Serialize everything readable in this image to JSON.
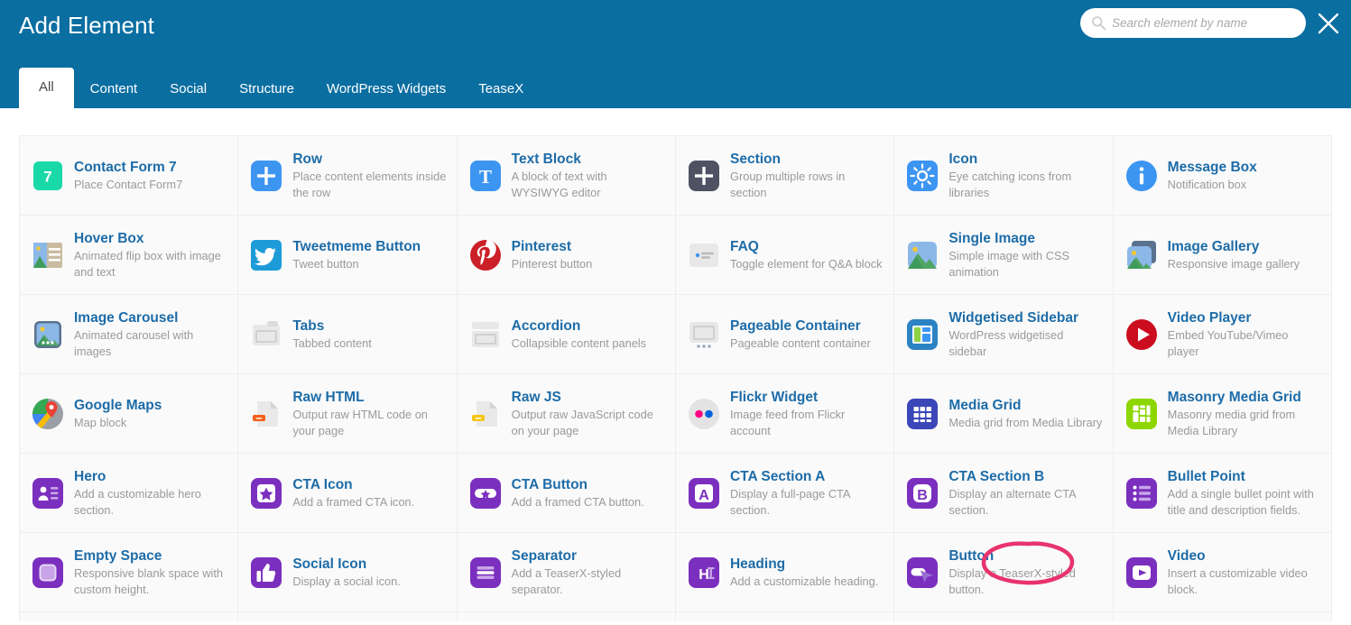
{
  "header": {
    "title": "Add Element",
    "brand_color": "#0a6ea1",
    "accent_color": "#1d6ca8",
    "close_icon": "close-icon"
  },
  "search": {
    "icon": "search-icon",
    "placeholder": "Search element by name",
    "value": ""
  },
  "tabs": [
    {
      "label": "All",
      "active": true
    },
    {
      "label": "Content",
      "active": false
    },
    {
      "label": "Social",
      "active": false
    },
    {
      "label": "Structure",
      "active": false
    },
    {
      "label": "WordPress Widgets",
      "active": false
    },
    {
      "label": "TeaseX",
      "active": false
    }
  ],
  "annotation": {
    "shape": "ellipse",
    "color": "#e8336d",
    "target": "Button",
    "note": "hand-drawn pink ellipse around the Button element title"
  },
  "elements": [
    {
      "title": "Contact Form 7",
      "desc": "Place Contact Form7",
      "icon": "contact-form-7-icon",
      "color": "#1ad9a8"
    },
    {
      "title": "Row",
      "desc": "Place content elements inside the row",
      "icon": "plus-square-icon",
      "color": "#3d95f2"
    },
    {
      "title": "Text Block",
      "desc": "A block of text with WYSIWYG editor",
      "icon": "text-block-icon",
      "color": "#3d95f2"
    },
    {
      "title": "Section",
      "desc": "Group multiple rows in section",
      "icon": "plus-square-dark-icon",
      "color": "#4e5262"
    },
    {
      "title": "Icon",
      "desc": "Eye catching icons from libraries",
      "icon": "sun-icon",
      "color": "#3d95f2"
    },
    {
      "title": "Message Box",
      "desc": "Notification box",
      "icon": "info-circle-icon",
      "color": "#3d95f2"
    },
    {
      "title": "Hover Box",
      "desc": "Animated flip box with image and text",
      "icon": "hover-box-icon",
      "color": "#c9bca0"
    },
    {
      "title": "Tweetmeme Button",
      "desc": "Tweet button",
      "icon": "twitter-icon",
      "color": "#1d9bd9"
    },
    {
      "title": "Pinterest",
      "desc": "Pinterest button",
      "icon": "pinterest-icon",
      "color": "#cb2027"
    },
    {
      "title": "FAQ",
      "desc": "Toggle element for Q&A block",
      "icon": "faq-icon",
      "color": "#e8e8e8"
    },
    {
      "title": "Single Image",
      "desc": "Simple image with CSS animation",
      "icon": "single-image-icon",
      "color": "#8cb8e8"
    },
    {
      "title": "Image Gallery",
      "desc": "Responsive image gallery",
      "icon": "image-gallery-icon",
      "color": "#5b728f"
    },
    {
      "title": "Image Carousel",
      "desc": "Animated carousel with images",
      "icon": "image-carousel-icon",
      "color": "#5b728f"
    },
    {
      "title": "Tabs",
      "desc": "Tabbed content",
      "icon": "tabs-icon",
      "color": "#e8e8e8"
    },
    {
      "title": "Accordion",
      "desc": "Collapsible content panels",
      "icon": "accordion-icon",
      "color": "#e8e8e8"
    },
    {
      "title": "Pageable Container",
      "desc": "Pageable content container",
      "icon": "pageable-container-icon",
      "color": "#e8e8e8"
    },
    {
      "title": "Widgetised Sidebar",
      "desc": "WordPress widgetised sidebar",
      "icon": "widgetised-sidebar-icon",
      "color": "#2b83c4"
    },
    {
      "title": "Video Player",
      "desc": "Embed YouTube/Vimeo player",
      "icon": "play-circle-icon",
      "color": "#cc0c1f"
    },
    {
      "title": "Google Maps",
      "desc": "Map block",
      "icon": "google-maps-icon",
      "color": "#34a853"
    },
    {
      "title": "Raw HTML",
      "desc": "Output raw HTML code on your page",
      "icon": "raw-html-icon",
      "color": "#f4601b"
    },
    {
      "title": "Raw JS",
      "desc": "Output raw JavaScript code on your page",
      "icon": "raw-js-icon",
      "color": "#f5c518"
    },
    {
      "title": "Flickr Widget",
      "desc": "Image feed from Flickr account",
      "icon": "flickr-icon",
      "color": "#ff0084"
    },
    {
      "title": "Media Grid",
      "desc": "Media grid from Media Library",
      "icon": "media-grid-icon",
      "color": "#3b46b8"
    },
    {
      "title": "Masonry Media Grid",
      "desc": "Masonry media grid from Media Library",
      "icon": "masonry-media-grid-icon",
      "color": "#8ed600"
    },
    {
      "title": "Hero",
      "desc": "Add a customizable hero section.",
      "icon": "hero-icon",
      "color": "#7b2fbe"
    },
    {
      "title": "CTA Icon",
      "desc": "Add a framed CTA icon.",
      "icon": "cta-icon-icon",
      "color": "#7b2fbe"
    },
    {
      "title": "CTA Button",
      "desc": "Add a framed CTA button.",
      "icon": "cta-button-icon",
      "color": "#7b2fbe"
    },
    {
      "title": "CTA Section A",
      "desc": "Display a full-page CTA section.",
      "icon": "cta-section-a-icon",
      "color": "#7b2fbe"
    },
    {
      "title": "CTA Section B",
      "desc": "Display an alternate CTA section.",
      "icon": "cta-section-b-icon",
      "color": "#7b2fbe"
    },
    {
      "title": "Bullet Point",
      "desc": "Add a single bullet point with title and description fields.",
      "icon": "bullet-point-icon",
      "color": "#7b2fbe"
    },
    {
      "title": "Empty Space",
      "desc": "Responsive blank space with custom height.",
      "icon": "empty-space-icon",
      "color": "#7b2fbe"
    },
    {
      "title": "Social Icon",
      "desc": "Display a social icon.",
      "icon": "thumbs-up-icon",
      "color": "#7b2fbe"
    },
    {
      "title": "Separator",
      "desc": "Add a TeaserX-styled separator.",
      "icon": "separator-icon",
      "color": "#7b2fbe"
    },
    {
      "title": "Heading",
      "desc": "Add a customizable heading.",
      "icon": "heading-icon",
      "color": "#7b2fbe"
    },
    {
      "title": "Button",
      "desc": "Display a TeaserX-styled button.",
      "icon": "button-icon",
      "color": "#7b2fbe"
    },
    {
      "title": "Video",
      "desc": "Insert a customizable video block.",
      "icon": "video-icon",
      "color": "#7b2fbe"
    }
  ]
}
